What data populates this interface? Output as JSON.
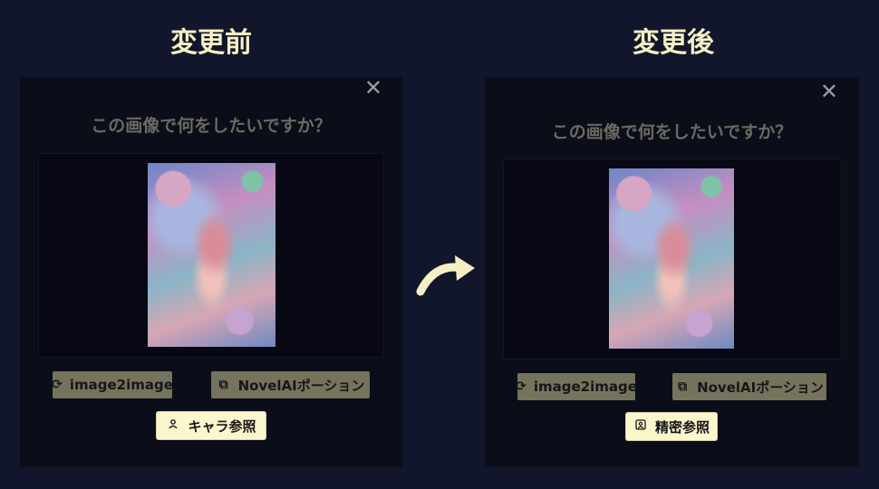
{
  "before": {
    "heading": "変更前",
    "dialog": {
      "close": "✕",
      "question": "この画像で何をしたいですか？",
      "buttons": {
        "img2img": "image2image",
        "potion": "NovelAIポーション",
        "reference": "キャラ参照"
      },
      "icons": {
        "img2img": "refresh-icon",
        "potion": "copy-icon",
        "reference": "person-icon"
      }
    }
  },
  "after": {
    "heading": "変更後",
    "dialog": {
      "close": "✕",
      "question": "この画像で何をしたいですか？",
      "buttons": {
        "img2img": "image2image",
        "potion": "NovelAIポーション",
        "reference": "精密参照"
      },
      "icons": {
        "img2img": "refresh-icon",
        "potion": "copy-icon",
        "reference": "portrait-icon"
      }
    }
  },
  "colors": {
    "background": "#12162c",
    "heading": "#f6efc4",
    "button": "#76735d",
    "button_active": "#fcf6cc"
  }
}
